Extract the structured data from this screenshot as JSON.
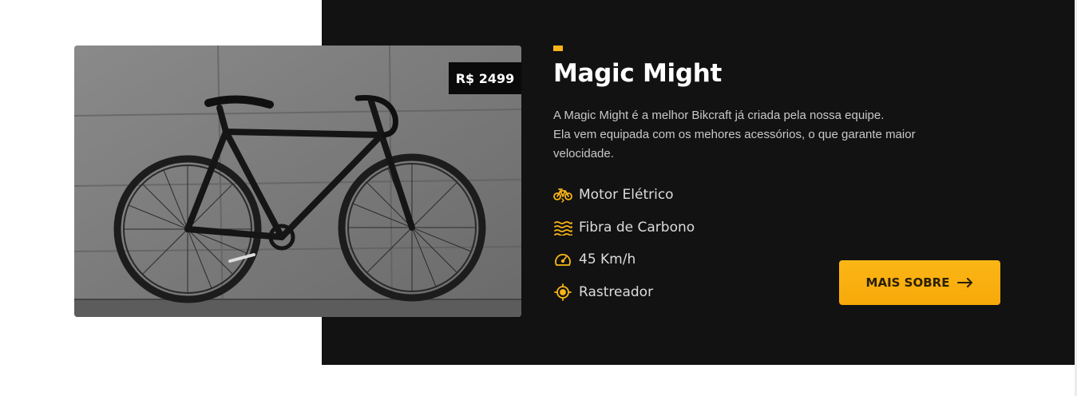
{
  "product": {
    "price": "R$ 2499",
    "title": "Magic Might",
    "description": [
      "A Magic Might é a melhor Bikcraft já criada pela nossa equipe.",
      "Ela vem equipada com os mehores acessórios, o que garante maior",
      "velocidade."
    ],
    "features": [
      {
        "icon": "electric-bike-icon",
        "label": "Motor Elétrico"
      },
      {
        "icon": "carbon-fiber-icon",
        "label": "Fibra de Carbono"
      },
      {
        "icon": "speedometer-icon",
        "label": "45 Km/h"
      },
      {
        "icon": "tracker-icon",
        "label": "Rastreador"
      }
    ],
    "cta_label": "MAIS SOBRE",
    "cta_icon": "arrow-right-icon",
    "image_alt": "bicycle-photo"
  },
  "colors": {
    "accent": "#fbb615",
    "panel": "#121212",
    "text_light": "#dcdcdc"
  }
}
